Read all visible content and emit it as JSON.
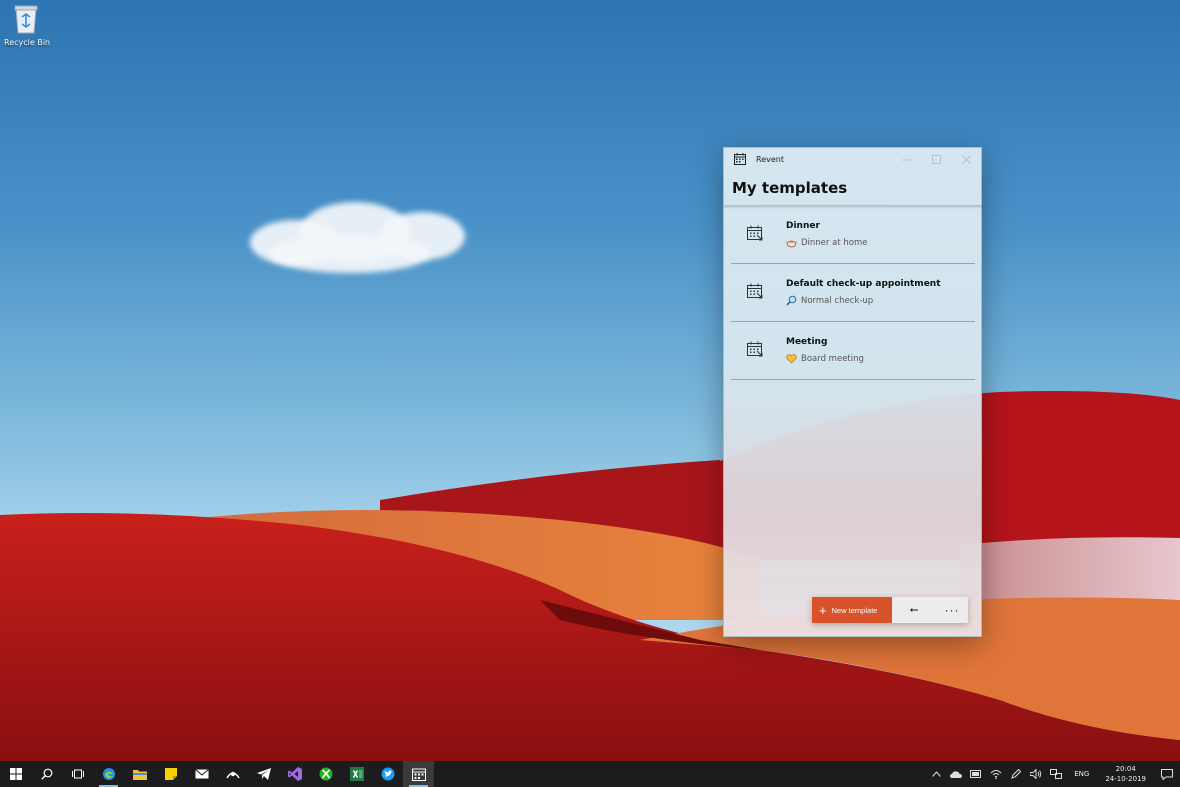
{
  "desktop": {
    "recycle_bin_label": "Recycle Bin"
  },
  "window": {
    "app_name": "Revent",
    "page_title": "My templates",
    "templates": [
      {
        "title": "Dinner",
        "subtitle": "Dinner at home",
        "emoji": "bowl-icon"
      },
      {
        "title": "Default check-up appointment",
        "subtitle": "Normal check-up",
        "emoji": "magnifier-icon"
      },
      {
        "title": "Meeting",
        "subtitle": "Board meeting",
        "emoji": "heart-icon"
      }
    ],
    "commands": {
      "new_template": "New template",
      "back_glyph": "⭠",
      "more_glyph": "···"
    },
    "accent_color": "#d8532c"
  },
  "taskbar": {
    "language": "ENG",
    "time": "20:04",
    "date": "24-10-2019"
  }
}
